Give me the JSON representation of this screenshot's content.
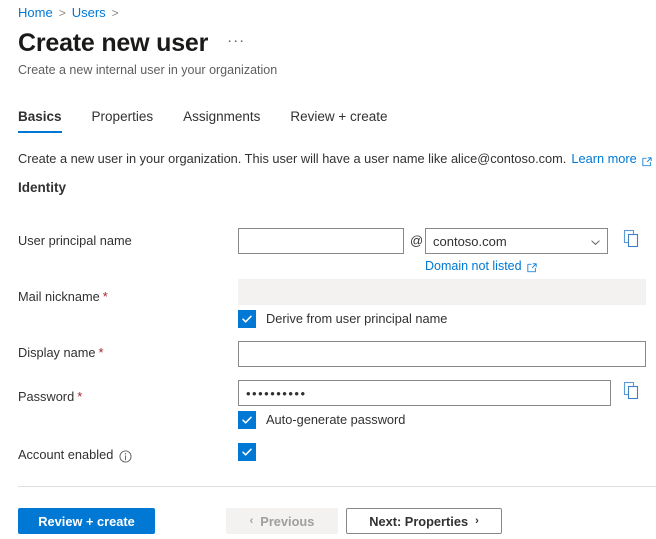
{
  "breadcrumb": {
    "items": [
      {
        "label": "Home"
      },
      {
        "label": "Users"
      }
    ],
    "separator": ">"
  },
  "header": {
    "title": "Create new user",
    "more_label": "···",
    "subtitle": "Create a new internal user in your organization"
  },
  "tabs": [
    {
      "label": "Basics",
      "active": true
    },
    {
      "label": "Properties",
      "active": false
    },
    {
      "label": "Assignments",
      "active": false
    },
    {
      "label": "Review + create",
      "active": false
    }
  ],
  "intro": {
    "text": "Create a new user in your organization. This user will have a user name like alice@contoso.com.",
    "link_label": "Learn more",
    "link_icon": "external-link-icon"
  },
  "section": {
    "heading": "Identity"
  },
  "fields": {
    "upn": {
      "label": "User principal name",
      "required": false,
      "value": "",
      "placeholder": "",
      "at_sign": "@",
      "domain_value": "contoso.com",
      "domain_chevron": "chevron-down-icon",
      "sublink_label": "Domain not listed",
      "sublink_icon": "external-link-icon",
      "copy_icon": "copy-icon"
    },
    "mail_nickname": {
      "label": "Mail nickname",
      "required": true,
      "required_mark": "*",
      "value": "",
      "disabled": true,
      "checkbox_label": "Derive from user principal name",
      "checkbox_checked": true
    },
    "display_name": {
      "label": "Display name",
      "required": true,
      "required_mark": "*",
      "value": "",
      "placeholder": ""
    },
    "password": {
      "label": "Password",
      "required": true,
      "required_mark": "*",
      "value": "••••••••••",
      "copy_icon": "copy-icon",
      "checkbox_label": "Auto-generate password",
      "checkbox_checked": true
    },
    "account_enabled": {
      "label": "Account enabled",
      "info_icon": "info-icon",
      "checked": true
    }
  },
  "footer": {
    "review_create_label": "Review + create",
    "previous_label": "Previous",
    "previous_glyph": "‹",
    "previous_disabled": true,
    "next_label": "Next: Properties",
    "next_glyph": "›"
  },
  "colors": {
    "accent": "#0078d4",
    "link": "#0078d4",
    "required": "#a4262c",
    "text": "#323130",
    "muted": "#605e5c",
    "border": "#8a8886",
    "disabled_bg": "#f3f2f1"
  }
}
